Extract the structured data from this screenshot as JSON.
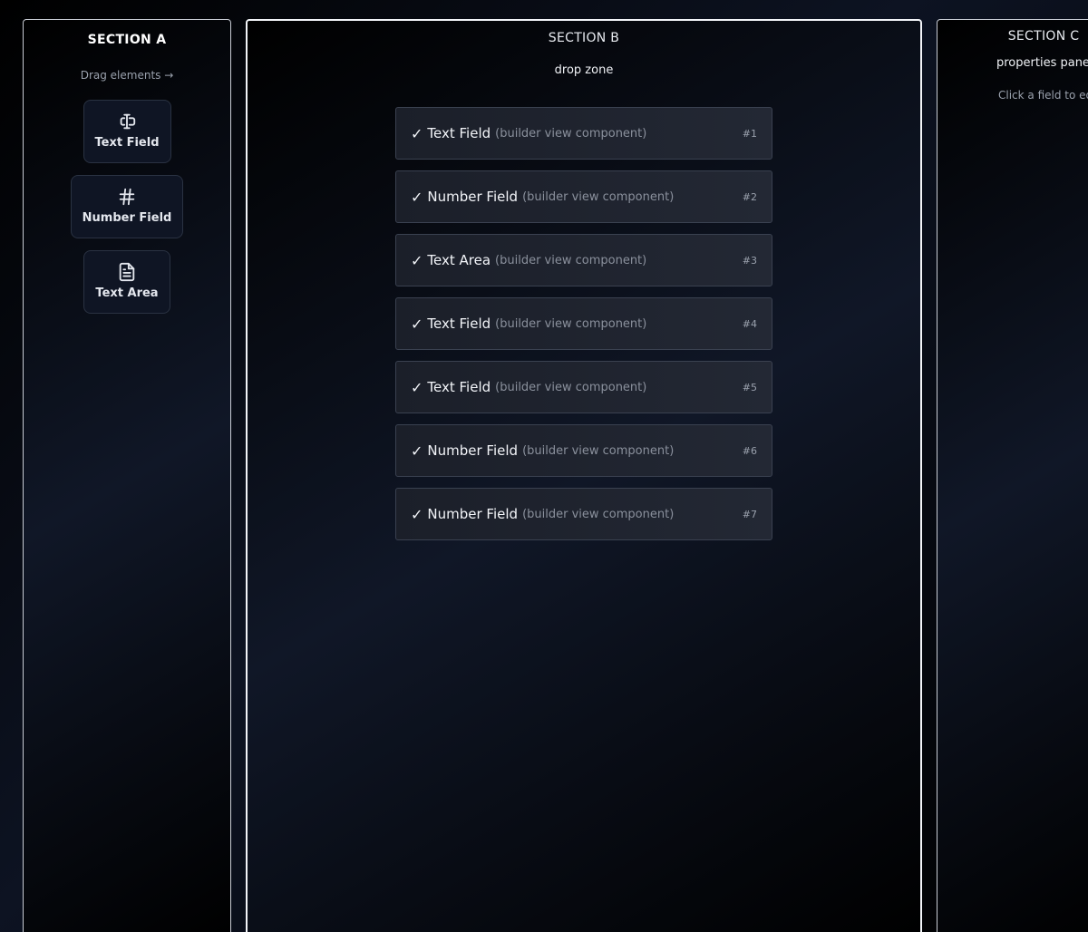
{
  "section_a": {
    "title": "SECTION A",
    "hint": "Drag elements →",
    "palette": [
      {
        "label": "Text Field",
        "icon": "text-cursor-input-icon"
      },
      {
        "label": "Number Field",
        "icon": "hash-icon"
      },
      {
        "label": "Text Area",
        "icon": "file-text-icon"
      }
    ]
  },
  "section_b": {
    "title": "SECTION B",
    "subtitle": "drop zone",
    "fields": [
      {
        "check": "✓",
        "name": "Text Field",
        "desc": "(builder view component)",
        "num": "#1"
      },
      {
        "check": "✓",
        "name": "Number Field",
        "desc": "(builder view component)",
        "num": "#2"
      },
      {
        "check": "✓",
        "name": "Text Area",
        "desc": "(builder view component)",
        "num": "#3"
      },
      {
        "check": "✓",
        "name": "Text Field",
        "desc": "(builder view component)",
        "num": "#4"
      },
      {
        "check": "✓",
        "name": "Text Field",
        "desc": "(builder view component)",
        "num": "#5"
      },
      {
        "check": "✓",
        "name": "Number Field",
        "desc": "(builder view component)",
        "num": "#6"
      },
      {
        "check": "✓",
        "name": "Number Field",
        "desc": "(builder view component)",
        "num": "#7"
      }
    ]
  },
  "section_c": {
    "title": "SECTION C",
    "subtitle": "properties panel",
    "hint": "Click a field to edit"
  },
  "colors": {
    "background": "#000000",
    "panel_border": "#c8ccd4",
    "card_bg": "#1b1f29",
    "muted_text": "#8a909c"
  }
}
